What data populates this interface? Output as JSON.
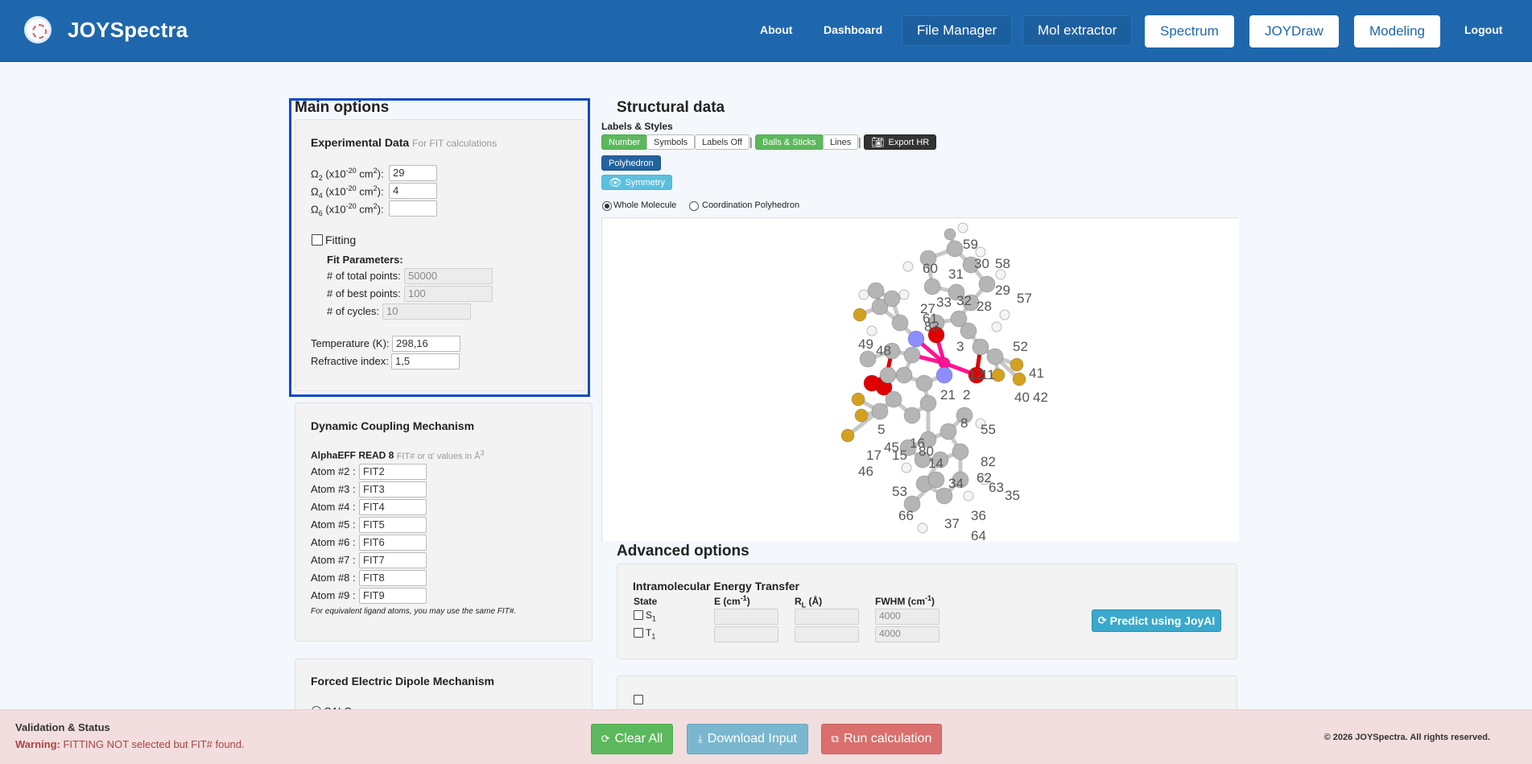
{
  "nav": {
    "brand": "JOYSpectra",
    "about": "About",
    "dashboard": "Dashboard",
    "file_manager": "File Manager",
    "mol_extractor": "Mol extractor",
    "spectrum": "Spectrum",
    "joydraw": "JOYDraw",
    "modeling": "Modeling",
    "logout": "Logout"
  },
  "main_options": {
    "title": "Main options",
    "exp_title": "Experimental Data",
    "exp_hint": "For FIT calculations",
    "omega_prefix": "Ω",
    "omega_unit_mid": " (x10",
    "omega_exp": "-20",
    "omega_unit_end": " cm",
    "omega_sq": "2",
    "omega_tail": "):",
    "omega2_sub": "2",
    "omega4_sub": "4",
    "omega6_sub": "6",
    "omega2_value": "29",
    "omega4_value": "4",
    "omega6_value": "",
    "fitting_label": "Fitting",
    "fit_params_title": "Fit Parameters:",
    "total_points_label": "# of total points:",
    "total_points_value": "50000",
    "best_points_label": "# of best points:",
    "best_points_value": "100",
    "cycles_label": "# of cycles:",
    "cycles_value": "10",
    "temperature_label": "Temperature (K):",
    "temperature_value": "298,16",
    "refractive_label": "Refractive index:",
    "refractive_value": "1,5"
  },
  "dcm": {
    "title": "Dynamic Coupling Mechanism",
    "alpha_title": "AlphaEFF READ 8",
    "alpha_hint_pre": "FIT# or α' values in Å",
    "alpha_hint_sup": "3",
    "atoms": [
      {
        "label": "Atom #2 :",
        "value": "FIT2"
      },
      {
        "label": "Atom #3 :",
        "value": "FIT3"
      },
      {
        "label": "Atom #4 :",
        "value": "FIT4"
      },
      {
        "label": "Atom #5 :",
        "value": "FIT5"
      },
      {
        "label": "Atom #6 :",
        "value": "FIT6"
      },
      {
        "label": "Atom #7 :",
        "value": "FIT7"
      },
      {
        "label": "Atom #8 :",
        "value": "FIT8"
      },
      {
        "label": "Atom #9 :",
        "value": "FIT9"
      }
    ],
    "note": "For equivalent ligand atoms, you may use the same FIT#."
  },
  "fedm": {
    "title": "Forced Electric Dipole Mechanism",
    "calc_label": "CALC"
  },
  "structural": {
    "title": "Structural data",
    "labels_styles": "Labels & Styles",
    "btn_number": "Number",
    "btn_symbols": "Symbols",
    "btn_labels_off": "Labels Off",
    "btn_balls": "Balls & Sticks",
    "btn_lines": "Lines",
    "btn_export": "Export HR",
    "btn_polyhedron": "Polyhedron",
    "btn_symmetry": "Symmetry",
    "radio_whole": "Whole Molecule",
    "radio_coord": "Coordination Polyhedron",
    "atom_labels": [
      "59",
      "60",
      "30",
      "58",
      "31",
      "29",
      "33",
      "32",
      "57",
      "61",
      "28",
      "27",
      "49",
      "3",
      "52",
      "41",
      "40",
      "42",
      "5",
      "2",
      "55",
      "46",
      "15",
      "34",
      "53",
      "63",
      "35",
      "66",
      "37",
      "36",
      "64",
      "62",
      "82",
      "16",
      "80",
      "17",
      "45",
      "14",
      "8",
      "83",
      "11",
      "12",
      "48",
      "21"
    ]
  },
  "advanced": {
    "title": "Advanced options",
    "iet_title": "Intramolecular Energy Transfer",
    "col_state": "State",
    "col_e": "E (cm",
    "col_e_sup": "-1",
    "col_e_end": ")",
    "col_rl": "R",
    "col_rl_sub": "L",
    "col_rl_end": " (Å)",
    "col_fwhm": "FWHM (cm",
    "col_fwhm_sup": "-1",
    "col_fwhm_end": ")",
    "s1_label": "S",
    "s1_sub": "1",
    "t1_label": "T",
    "t1_sub": "1",
    "s1_fwhm": "4000",
    "t1_fwhm": "4000",
    "predict_label": "Predict using JoyAI"
  },
  "footer": {
    "title": "Validation & Status",
    "warning_prefix": "Warning:",
    "warning_text": " FITTING NOT selected but FIT# found.",
    "clear_all": "Clear All",
    "download_input": "Download Input",
    "run_calculation": "Run calculation",
    "copyright": "© 2026 JOYSpectra. All rights reserved."
  },
  "colors": {
    "navbar": "#1f67ad",
    "highlight": "#1147c9",
    "clear_all": "#5cb85c",
    "download": "#7ab7cf",
    "run": "#d9706d",
    "carbon": "#b5b5b5",
    "oxygen": "#e00000",
    "fluorine": "#d4a020",
    "nitrogen": "#8d8dff",
    "metal": "#ff1493"
  }
}
